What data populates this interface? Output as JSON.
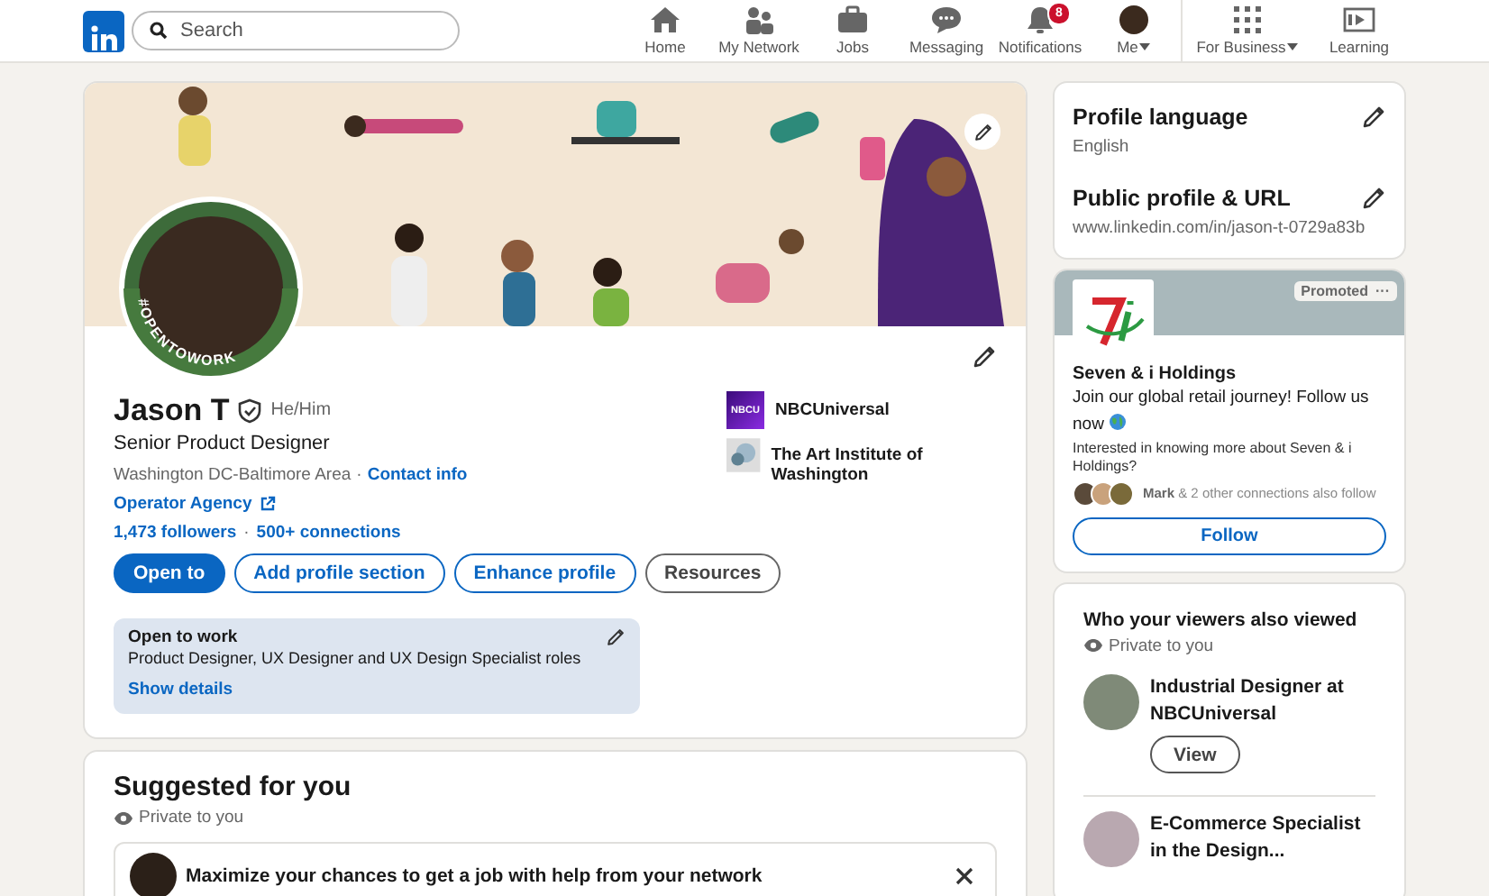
{
  "nav": {
    "search": {
      "placeholder": "Search"
    },
    "items": [
      {
        "kind": "home",
        "label": "Home"
      },
      {
        "kind": "network",
        "label": "My Network"
      },
      {
        "kind": "jobs",
        "label": "Jobs"
      },
      {
        "kind": "messaging",
        "label": "Messaging"
      },
      {
        "kind": "notifications",
        "label": "Notifications",
        "badge": "8"
      },
      {
        "kind": "me",
        "label": "Me",
        "caret": true
      },
      {
        "kind": "business",
        "label": "For Business",
        "caret": true
      },
      {
        "kind": "learning",
        "label": "Learning"
      }
    ]
  },
  "profile": {
    "frame_text": "#OPENTOWORK",
    "name": "Jason T",
    "verified": true,
    "pronouns": "He/Him",
    "headline": "Senior Product Designer",
    "location": "Washington DC-Baltimore Area",
    "location_separator": "·",
    "contact_link": "Contact info",
    "stats_separator": "·",
    "website": "Operator Agency",
    "followers": "1,473 followers",
    "connections": "500+ connections",
    "actions": [
      {
        "label": "Open to",
        "kind": "primary"
      },
      {
        "label": "Add profile section",
        "kind": "outline"
      },
      {
        "label": "Enhance profile",
        "kind": "outline"
      },
      {
        "label": "Resources",
        "kind": "neutral"
      }
    ],
    "organizations": [
      {
        "kind": "company",
        "name": "NBCUniversal",
        "logo_text": "NBCU"
      },
      {
        "kind": "school",
        "name": "The Art Institute of Washington"
      }
    ],
    "open_to_work": {
      "title": "Open to work",
      "roles": "Product Designer, UX Designer and UX Design Specialist roles",
      "link": "Show details"
    }
  },
  "suggested": {
    "title": "Suggested for you",
    "visibility": "Private to you",
    "items": [
      {
        "text": "Maximize your chances to get a job with help from your network"
      }
    ]
  },
  "settings": [
    {
      "title": "Profile language",
      "value": "English"
    },
    {
      "title": "Public profile & URL",
      "value": "www.linkedin.com/in/jason-t-0729a83b"
    }
  ],
  "ad": {
    "badge": "Promoted",
    "menu": "···",
    "company": "Seven & i Holdings",
    "message_lines": [
      "Join our global retail journey! Follow us",
      "now"
    ],
    "prompt": "Interested in knowing more about Seven & i Holdings?",
    "connections": "**Mark** & 2 other connections also follow",
    "button": "Follow"
  },
  "viewers": {
    "title": "Who your viewers also viewed",
    "visibility": "Private to you",
    "people": [
      {
        "headline": "Industrial Designer at NBCUniversal",
        "button": "View"
      },
      {
        "headline": "E-Commerce Specialist in the Design..."
      }
    ]
  }
}
